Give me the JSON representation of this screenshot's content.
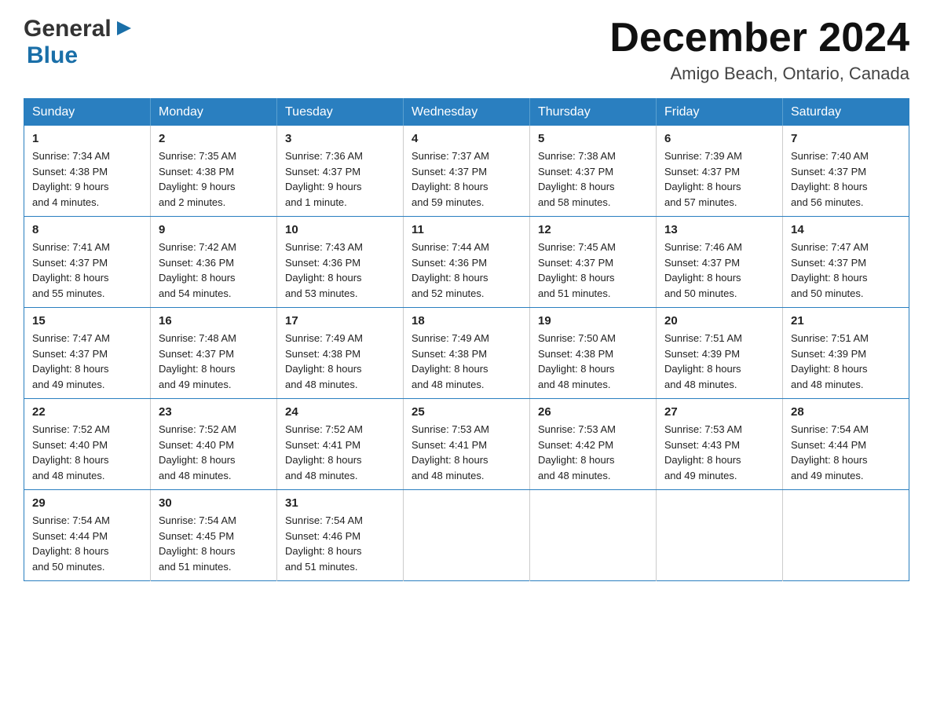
{
  "header": {
    "logo_general": "General",
    "logo_blue": "Blue",
    "month_title": "December 2024",
    "location": "Amigo Beach, Ontario, Canada"
  },
  "days_of_week": [
    "Sunday",
    "Monday",
    "Tuesday",
    "Wednesday",
    "Thursday",
    "Friday",
    "Saturday"
  ],
  "weeks": [
    [
      {
        "day": "1",
        "sunrise": "7:34 AM",
        "sunset": "4:38 PM",
        "daylight": "9 hours and 4 minutes."
      },
      {
        "day": "2",
        "sunrise": "7:35 AM",
        "sunset": "4:38 PM",
        "daylight": "9 hours and 2 minutes."
      },
      {
        "day": "3",
        "sunrise": "7:36 AM",
        "sunset": "4:37 PM",
        "daylight": "9 hours and 1 minute."
      },
      {
        "day": "4",
        "sunrise": "7:37 AM",
        "sunset": "4:37 PM",
        "daylight": "8 hours and 59 minutes."
      },
      {
        "day": "5",
        "sunrise": "7:38 AM",
        "sunset": "4:37 PM",
        "daylight": "8 hours and 58 minutes."
      },
      {
        "day": "6",
        "sunrise": "7:39 AM",
        "sunset": "4:37 PM",
        "daylight": "8 hours and 57 minutes."
      },
      {
        "day": "7",
        "sunrise": "7:40 AM",
        "sunset": "4:37 PM",
        "daylight": "8 hours and 56 minutes."
      }
    ],
    [
      {
        "day": "8",
        "sunrise": "7:41 AM",
        "sunset": "4:37 PM",
        "daylight": "8 hours and 55 minutes."
      },
      {
        "day": "9",
        "sunrise": "7:42 AM",
        "sunset": "4:36 PM",
        "daylight": "8 hours and 54 minutes."
      },
      {
        "day": "10",
        "sunrise": "7:43 AM",
        "sunset": "4:36 PM",
        "daylight": "8 hours and 53 minutes."
      },
      {
        "day": "11",
        "sunrise": "7:44 AM",
        "sunset": "4:36 PM",
        "daylight": "8 hours and 52 minutes."
      },
      {
        "day": "12",
        "sunrise": "7:45 AM",
        "sunset": "4:37 PM",
        "daylight": "8 hours and 51 minutes."
      },
      {
        "day": "13",
        "sunrise": "7:46 AM",
        "sunset": "4:37 PM",
        "daylight": "8 hours and 50 minutes."
      },
      {
        "day": "14",
        "sunrise": "7:47 AM",
        "sunset": "4:37 PM",
        "daylight": "8 hours and 50 minutes."
      }
    ],
    [
      {
        "day": "15",
        "sunrise": "7:47 AM",
        "sunset": "4:37 PM",
        "daylight": "8 hours and 49 minutes."
      },
      {
        "day": "16",
        "sunrise": "7:48 AM",
        "sunset": "4:37 PM",
        "daylight": "8 hours and 49 minutes."
      },
      {
        "day": "17",
        "sunrise": "7:49 AM",
        "sunset": "4:38 PM",
        "daylight": "8 hours and 48 minutes."
      },
      {
        "day": "18",
        "sunrise": "7:49 AM",
        "sunset": "4:38 PM",
        "daylight": "8 hours and 48 minutes."
      },
      {
        "day": "19",
        "sunrise": "7:50 AM",
        "sunset": "4:38 PM",
        "daylight": "8 hours and 48 minutes."
      },
      {
        "day": "20",
        "sunrise": "7:51 AM",
        "sunset": "4:39 PM",
        "daylight": "8 hours and 48 minutes."
      },
      {
        "day": "21",
        "sunrise": "7:51 AM",
        "sunset": "4:39 PM",
        "daylight": "8 hours and 48 minutes."
      }
    ],
    [
      {
        "day": "22",
        "sunrise": "7:52 AM",
        "sunset": "4:40 PM",
        "daylight": "8 hours and 48 minutes."
      },
      {
        "day": "23",
        "sunrise": "7:52 AM",
        "sunset": "4:40 PM",
        "daylight": "8 hours and 48 minutes."
      },
      {
        "day": "24",
        "sunrise": "7:52 AM",
        "sunset": "4:41 PM",
        "daylight": "8 hours and 48 minutes."
      },
      {
        "day": "25",
        "sunrise": "7:53 AM",
        "sunset": "4:41 PM",
        "daylight": "8 hours and 48 minutes."
      },
      {
        "day": "26",
        "sunrise": "7:53 AM",
        "sunset": "4:42 PM",
        "daylight": "8 hours and 48 minutes."
      },
      {
        "day": "27",
        "sunrise": "7:53 AM",
        "sunset": "4:43 PM",
        "daylight": "8 hours and 49 minutes."
      },
      {
        "day": "28",
        "sunrise": "7:54 AM",
        "sunset": "4:44 PM",
        "daylight": "8 hours and 49 minutes."
      }
    ],
    [
      {
        "day": "29",
        "sunrise": "7:54 AM",
        "sunset": "4:44 PM",
        "daylight": "8 hours and 50 minutes."
      },
      {
        "day": "30",
        "sunrise": "7:54 AM",
        "sunset": "4:45 PM",
        "daylight": "8 hours and 51 minutes."
      },
      {
        "day": "31",
        "sunrise": "7:54 AM",
        "sunset": "4:46 PM",
        "daylight": "8 hours and 51 minutes."
      },
      null,
      null,
      null,
      null
    ]
  ],
  "labels": {
    "sunrise": "Sunrise:",
    "sunset": "Sunset:",
    "daylight": "Daylight:"
  }
}
